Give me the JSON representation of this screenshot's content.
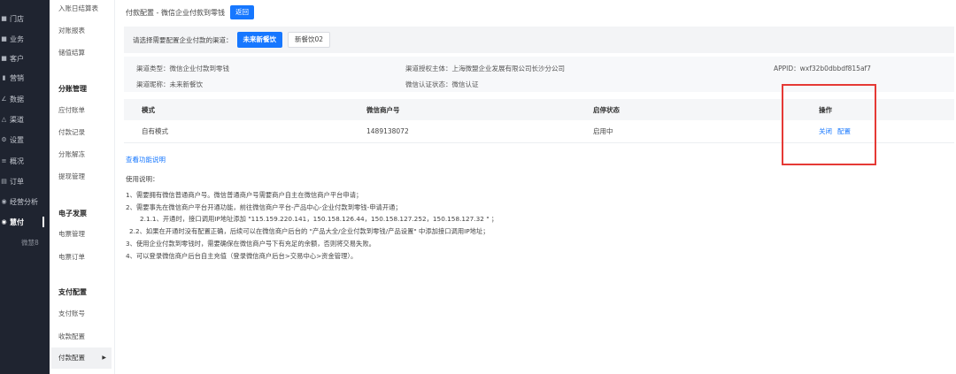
{
  "nav": {
    "items": [
      {
        "icon": "■",
        "label": "门店",
        "name": "store-icon"
      },
      {
        "icon": "■",
        "label": "业务",
        "name": "business-icon"
      },
      {
        "icon": "■",
        "label": "客户",
        "name": "customer-icon"
      },
      {
        "icon": "▮",
        "label": "营销",
        "name": "marketing-icon"
      },
      {
        "icon": "∠",
        "label": "数据",
        "name": "data-icon"
      },
      {
        "icon": "△",
        "label": "渠道",
        "name": "channel-icon"
      },
      {
        "icon": "⚙",
        "label": "设置",
        "name": "settings-icon"
      },
      {
        "icon": "≡",
        "label": "概况",
        "name": "overview-icon"
      },
      {
        "icon": "▤",
        "label": "订单",
        "name": "order-icon"
      },
      {
        "icon": "◉",
        "label": "经营分析",
        "name": "analysis-icon"
      },
      {
        "icon": "◉",
        "label": "慧付",
        "name": "huifu-icon"
      }
    ],
    "sub_label": "微慧8"
  },
  "menu": {
    "top_items": [
      "入账日结算表",
      "对账报表",
      "储值结算"
    ],
    "groups": [
      {
        "title": "分账管理",
        "items": [
          "应付账单",
          "付款记录",
          "分账解冻",
          "提现管理"
        ]
      },
      {
        "title": "电子发票",
        "items": [
          "电票管理",
          "电票订单"
        ]
      },
      {
        "title": "支付配置",
        "items": [
          "支付账号",
          "收款配置",
          "付款配置"
        ]
      }
    ]
  },
  "header": {
    "breadcrumb": "付款配置 - 微信企业付款到零钱",
    "back_label": "返回"
  },
  "channel": {
    "label": "请选择需要配置企业付款的渠道：",
    "options": [
      "未来新餐饮",
      "新餐饮02"
    ]
  },
  "info": {
    "type": "渠道类型：微信企业付款到零钱",
    "authority": "渠道授权主体：上海微盟企业发展有限公司长沙分公司",
    "appid": "APPID：wxf32b0dbbdf815af7",
    "name": "渠道昵称：未来新餐饮",
    "cert": "微信认证状态：微信认证"
  },
  "table": {
    "headers": [
      "模式",
      "微信商户号",
      "启停状态",
      "操作"
    ],
    "row": {
      "mode": "自有模式",
      "merchant_id": "1489138072",
      "status": "启用中",
      "close": "关闭",
      "config": "配置"
    }
  },
  "help": {
    "link": "查看功能说明",
    "title": "使用说明：",
    "lines": [
      "1、需要拥有微信普通商户号。微信普通商户号需要商户自主在微信商户平台申请；",
      "2、需要事先在微信商户平台开通功能，前往微信商户平台-产品中心-企业付款到零钱-申请开通；",
      "2.1.1、开通时，接口调用IP地址添加 \"115.159.220.141，150.158.126.44，150.158.127.252，150.158.127.32 \" ；",
      "2.2、如果在开通时没有配置正确，后续可以在微信商户后台的 \"产品大全/企业付款到零钱/产品设置\" 中添加接口调用IP地址；",
      "3、使用企业付款到零钱时，需要确保在微信商户号下有充足的余额，否则将交易失败。",
      "4、可以登录微信商户后台自主充值（登录微信商户后台>交易中心>资金管理）。"
    ]
  }
}
